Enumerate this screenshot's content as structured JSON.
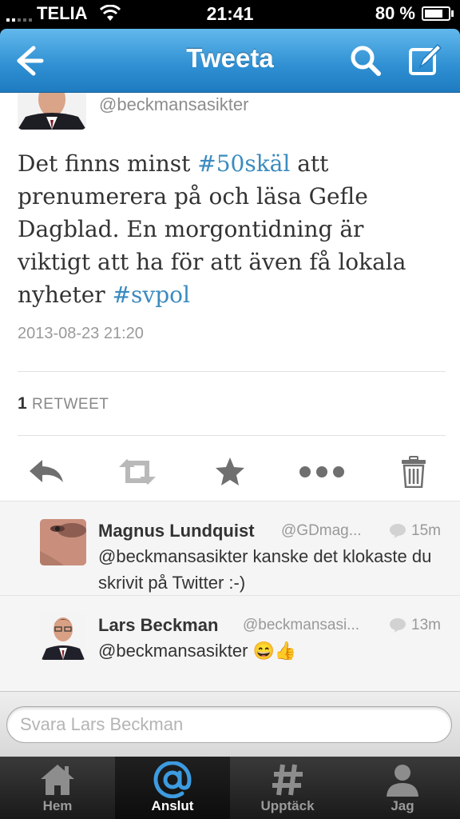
{
  "status_bar": {
    "carrier": "TELIA",
    "time": "21:41",
    "battery": "80 %"
  },
  "nav": {
    "title": "Tweeta",
    "back_icon": "back-arrow-icon",
    "search_icon": "search-icon",
    "compose_icon": "compose-icon",
    "accent_color": "#2e8fd2"
  },
  "tweet": {
    "handle": "@beckmansasikter",
    "text_parts": {
      "p1": "Det finns minst ",
      "tag1": "#50skäl",
      "p2": " att prenumerera på och läsa Gefle Dagblad. En morgontidning är viktigt att ha för att även få lokala nyheter ",
      "tag2": "#svpol"
    },
    "timestamp": "2013-08-23 21:20",
    "retweet_count": "1",
    "retweet_label": "RETWEET"
  },
  "actions": [
    "reply-icon",
    "retweet-icon",
    "favorite-icon",
    "more-icon",
    "delete-icon"
  ],
  "replies": [
    {
      "name": "Magnus Lundquist",
      "handle": "@GDmag...",
      "time": "15m",
      "text": "@beckmansasikter kanske det klokaste du skrivit på Twitter :-)"
    },
    {
      "name": "Lars Beckman",
      "handle": "@beckmansasi...",
      "time": "13m",
      "text": "@beckmansasikter 😄👍"
    }
  ],
  "reply_box": {
    "placeholder": "Svara Lars Beckman"
  },
  "tabs": [
    {
      "label": "Hem",
      "icon": "home-icon"
    },
    {
      "label": "Anslut",
      "icon": "at-icon"
    },
    {
      "label": "Upptäck",
      "icon": "hashtag-icon"
    },
    {
      "label": "Jag",
      "icon": "person-icon"
    }
  ]
}
